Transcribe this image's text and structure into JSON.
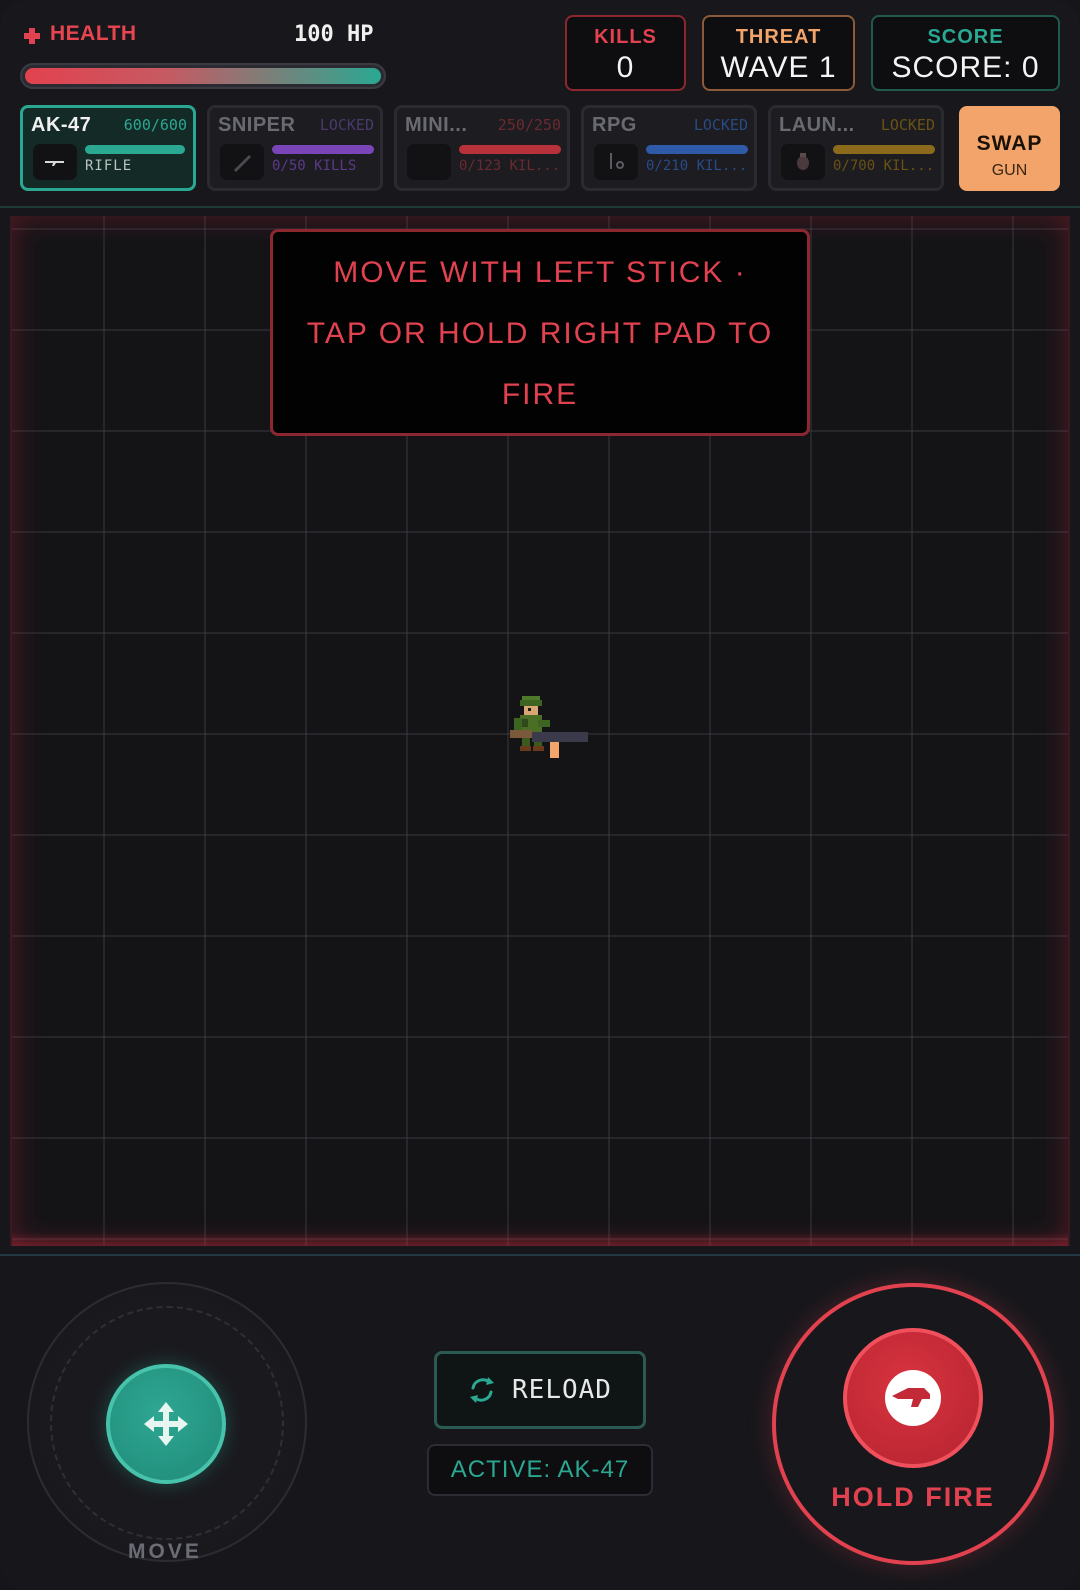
{
  "hud": {
    "health_label": "HEALTH",
    "hp_text": "100 HP",
    "health_fraction": 1.0,
    "kills": {
      "label": "KILLS",
      "value": "0"
    },
    "threat": {
      "label": "THREAT",
      "value": "WAVE 1"
    },
    "score": {
      "label": "SCORE",
      "value": "SCORE: 0"
    }
  },
  "weapons": [
    {
      "name": "AK-47",
      "status": "600/600",
      "sub": "RIFLE",
      "color": "#2aa892",
      "icon": "rifle-icon",
      "active": true
    },
    {
      "name": "SNIPER",
      "status": "LOCKED",
      "sub": "0/50 KILLS",
      "color": "#7a45b8",
      "icon": "sniper-icon",
      "active": false
    },
    {
      "name": "MINI...",
      "status": "250/250",
      "sub": "0/123 KIL...",
      "color": "#b8323c",
      "icon": "minigun-icon",
      "active": false
    },
    {
      "name": "RPG",
      "status": "LOCKED",
      "sub": "0/210 KIL...",
      "color": "#2e5aa8",
      "icon": "rpg-icon",
      "active": false
    },
    {
      "name": "LAUN...",
      "status": "LOCKED",
      "sub": "0/700 KIL...",
      "color": "#8c6a1c",
      "icon": "launcher-icon",
      "active": false
    }
  ],
  "swap": {
    "line1": "SWAP",
    "line2": "GUN"
  },
  "banner": {
    "line1": "MOVE WITH LEFT STICK ·",
    "line2": "TAP OR HOLD RIGHT PAD TO",
    "line3": "FIRE"
  },
  "controls": {
    "move_label": "MOVE",
    "reload_label": "RELOAD",
    "active_weapon": "ACTIVE: AK-47",
    "fire_label": "HOLD FIRE"
  },
  "colors": {
    "accent_teal": "#2aa892",
    "accent_red": "#e2424f",
    "accent_orange": "#f2a46a"
  }
}
